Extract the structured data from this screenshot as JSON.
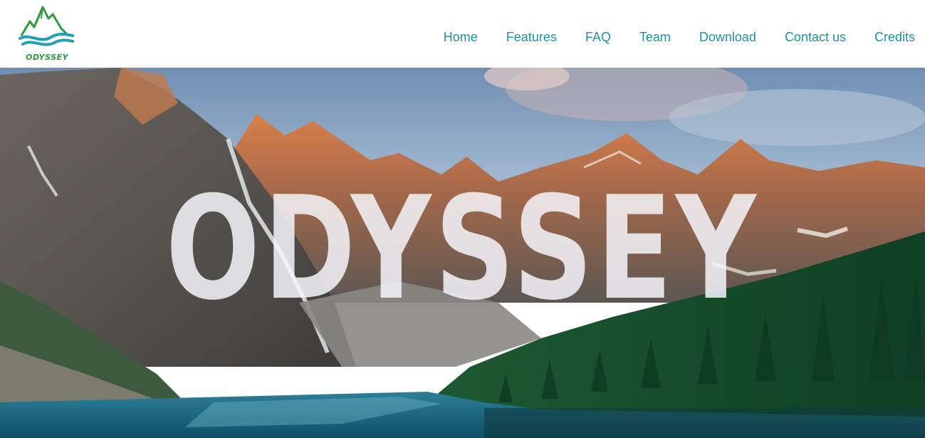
{
  "brand": {
    "logo_text": "ODYSSEY",
    "logo_icon": "mountain-wave-logo",
    "colors": {
      "green": "#2a9a3a",
      "teal": "#22a0b6"
    }
  },
  "nav": {
    "color": "#1f93a5",
    "items": [
      {
        "label": "Home"
      },
      {
        "label": "Features"
      },
      {
        "label": "FAQ"
      },
      {
        "label": "Team"
      },
      {
        "label": "Download"
      },
      {
        "label": "Contact us"
      },
      {
        "label": "Credits"
      }
    ]
  },
  "hero": {
    "title": "ODYSSEY",
    "image": "mountain-lake-landscape"
  }
}
